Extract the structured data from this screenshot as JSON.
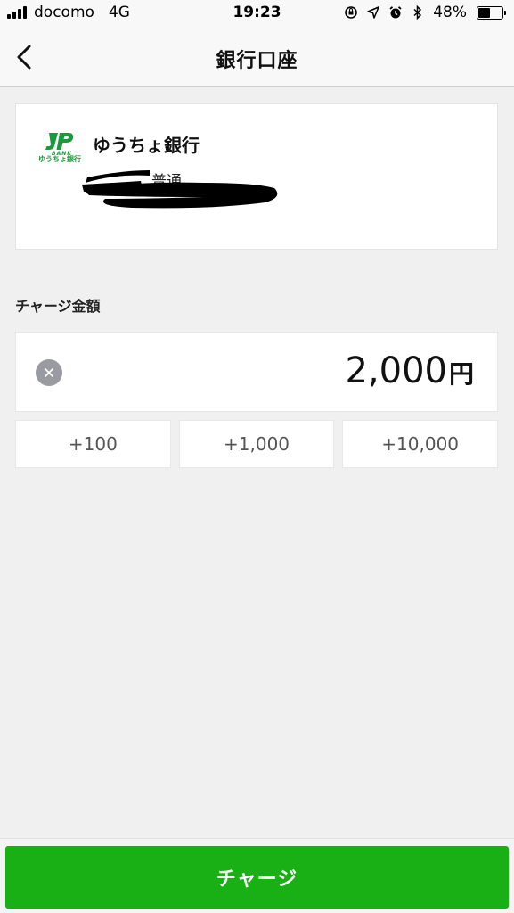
{
  "status_bar": {
    "carrier": "docomo",
    "network": "4G",
    "time": "19:23",
    "battery_percent": "48%",
    "battery_level": 0.48,
    "icons": [
      "orientation-lock-icon",
      "location-arrow-icon",
      "alarm-icon",
      "bluetooth-icon"
    ]
  },
  "header": {
    "title": "銀行口座",
    "back_icon": "chevron-left-icon"
  },
  "bank": {
    "logo_text": "JP",
    "logo_sub": "BANK",
    "logo_caption": "ゆうちょ銀行",
    "name": "ゆうちょ銀行",
    "account_type": "普通",
    "brand_color": "#1a9a3c"
  },
  "charge": {
    "section_label": "チャージ金額",
    "amount": "2,000",
    "unit": "円",
    "clear_icon": "clear-x-icon",
    "increments": [
      "+100",
      "+1,000",
      "+10,000"
    ],
    "button_label": "チャージ",
    "accent_color": "#19b016"
  }
}
